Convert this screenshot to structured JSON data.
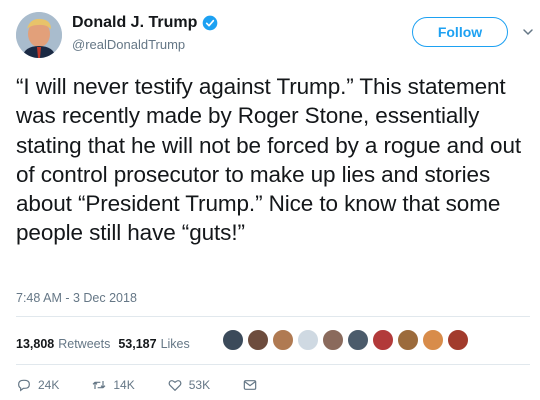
{
  "tweet": {
    "display_name": "Donald J. Trump",
    "handle": "@realDonaldTrump",
    "follow_label": "Follow",
    "text": "“I will never testify against Trump.” This statement was recently made by Roger Stone, essentially stating that he will not be forced by a rogue and out of control prosecutor to make up lies and stories about “President Trump.” Nice to know that some people still have “guts!”",
    "timestamp": "7:48 AM - 3 Dec 2018"
  },
  "stats": {
    "retweets_count": "13,808",
    "retweets_label": "Retweets",
    "likes_count": "53,187",
    "likes_label": "Likes"
  },
  "actions": {
    "reply_count": "24K",
    "retweet_count": "14K",
    "like_count": "53K"
  },
  "colors": {
    "accent": "#1da1f2",
    "text": "#14171a",
    "muted": "#657786",
    "divider": "#e1e8ed"
  },
  "icons": [
    "verified-badge-icon",
    "chevron-down-icon",
    "reply-icon",
    "retweet-icon",
    "heart-icon",
    "direct-message-icon"
  ]
}
